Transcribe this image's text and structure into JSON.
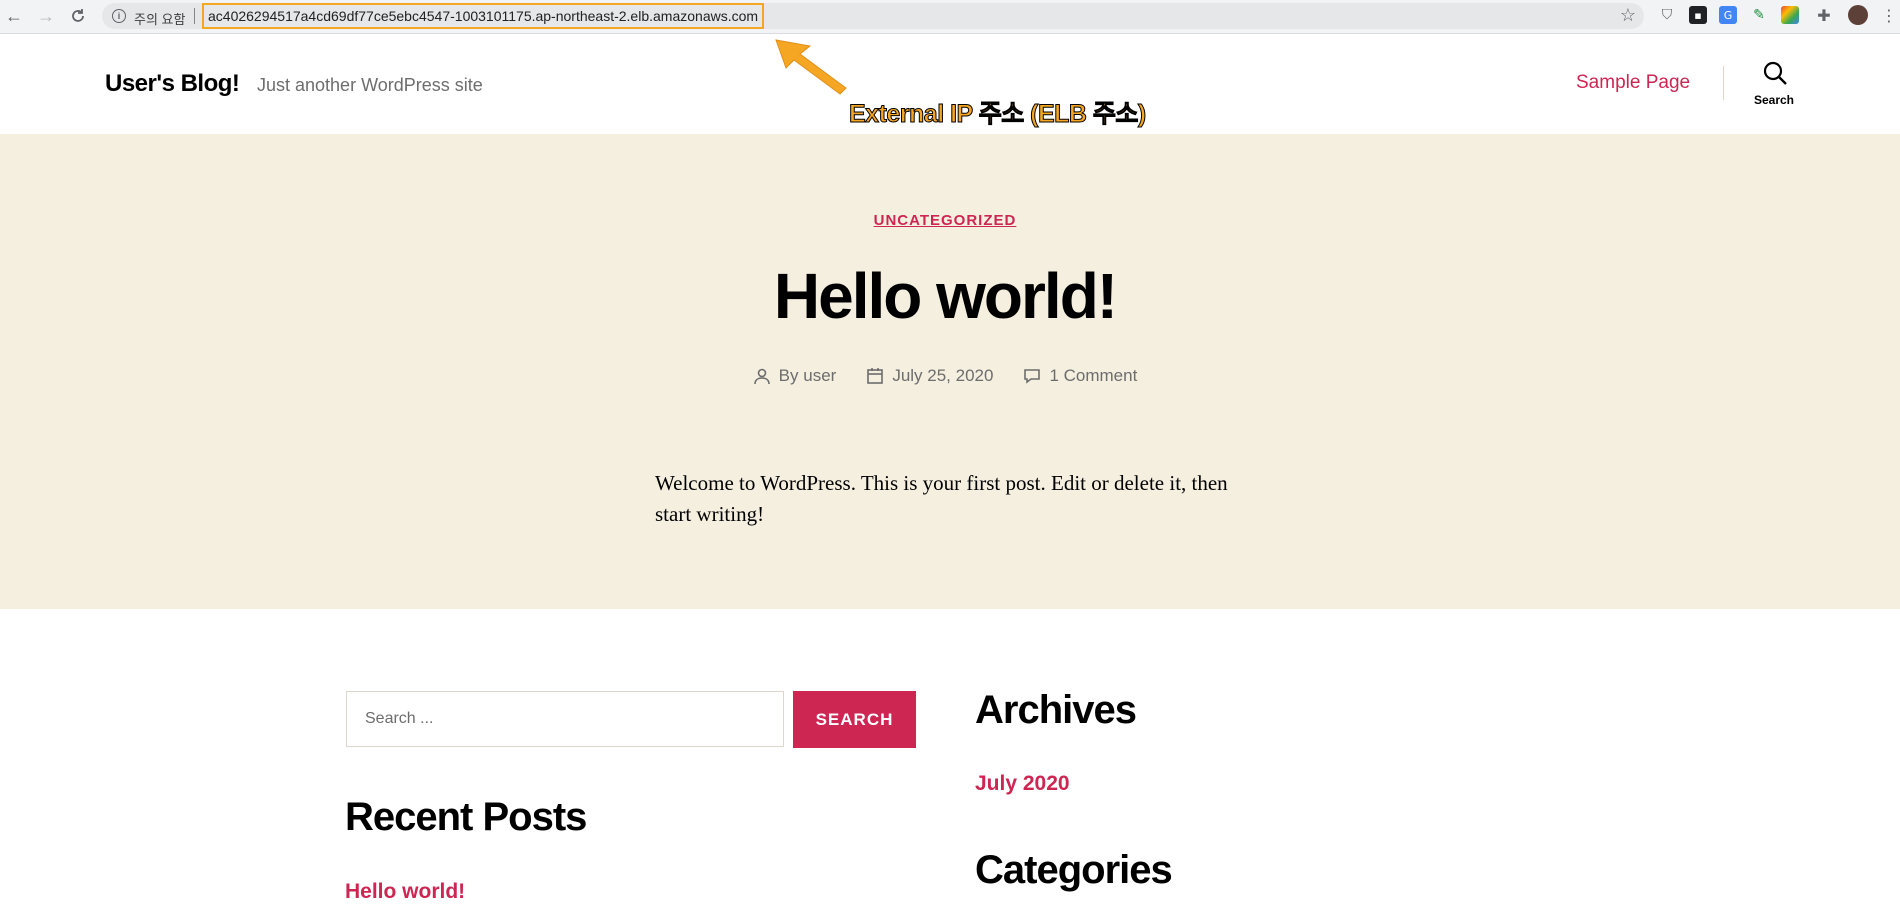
{
  "browser": {
    "security_label": "주의 요함",
    "url": "ac4026294517a4cd69df77ce5ebc4547-1003101175.ap-northeast-2.elb.amazonaws.com",
    "icons": [
      "back-icon",
      "forward-icon",
      "reload-icon",
      "info-icon",
      "star-icon",
      "extension-icons",
      "profile-avatar",
      "menu-icon"
    ]
  },
  "annotation": {
    "text": "External IP 주소 (ELB 주소)",
    "color": "#f5a623"
  },
  "header": {
    "site_title": "User's Blog!",
    "site_description": "Just another WordPress site",
    "menu_item": "Sample Page",
    "search_label": "Search"
  },
  "post": {
    "category": "UNCATEGORIZED",
    "title": "Hello world!",
    "author": "By user",
    "date": "July 25, 2020",
    "comments": "1 Comment",
    "excerpt": "Welcome to WordPress. This is your first post. Edit or delete it, then start writing!"
  },
  "widgets": {
    "search_placeholder": "Search ...",
    "search_button": "SEARCH",
    "recent_posts_title": "Recent Posts",
    "recent_post_1": "Hello world!",
    "archives_title": "Archives",
    "archive_1": "July 2020",
    "categories_title": "Categories"
  },
  "colors": {
    "accent": "#cd2653",
    "hero_bg": "#f5efe0",
    "text": "#000000",
    "muted": "#6d6d6d"
  }
}
